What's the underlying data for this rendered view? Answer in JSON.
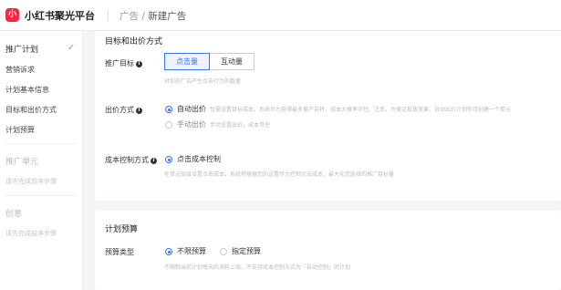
{
  "header": {
    "logo_text": "小",
    "brand": "小红书聚光平台",
    "crumb_parent": "广告",
    "crumb_sep": "/",
    "crumb_current": "新建广告"
  },
  "sidebar": {
    "plan": {
      "title": "推广计划",
      "done_icon": "check-icon",
      "items": [
        "营销诉求",
        "计划基本信息",
        "目标和出价方式",
        "计划预算"
      ]
    },
    "unit": {
      "title": "推广单元",
      "hint": "请先完成前序步骤"
    },
    "creative": {
      "title": "创意",
      "hint": "请先完成前序步骤"
    }
  },
  "bid_section": {
    "title": "目标和出价方式",
    "goal_label": "推广目标",
    "goal_options": [
      "点击量",
      "互动量"
    ],
    "goal_selected": "点击量",
    "goal_hint": "对你的广告产生点击行为的数量",
    "bid_label": "出价方式",
    "bid_options": [
      {
        "label": "自动出价",
        "desc": "仅需设置目标成本，系统尽力获得最多量产自转，成本大概率可控。注意，为保证投放效果，自动出价计划仅可创建一个单元",
        "selected": true
      },
      {
        "label": "手动出价",
        "desc": "手动设置出价，成本可控",
        "selected": false
      }
    ],
    "cost_label": "成本控制方式",
    "cost_option": "点击成本控制",
    "cost_hint": "在单元层级设置点击成本，系统将根据您的设置尽力控制点击成本，最大化您选择的推广目标量"
  },
  "budget_section": {
    "title": "计划预算",
    "type_label": "预算类型",
    "options": [
      "不限预算",
      "指定预算"
    ],
    "selected": "不限预算",
    "hint": "不限制当前计划每天的消耗上限，不支持成本控制方式为「自动控制」的计划"
  },
  "colors": {
    "accent": "#3b72e8",
    "brand": "#ff2442"
  }
}
